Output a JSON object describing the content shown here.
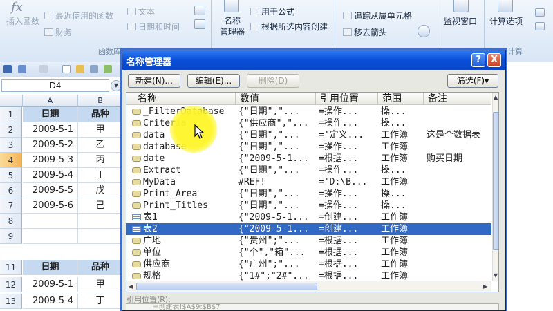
{
  "ribbon": {
    "insert_function": "插入函数",
    "recent": "最近使用的函数",
    "finance": "财务",
    "text": "文本",
    "datetime": "日期和时间",
    "function_library": "函数库",
    "name_manager": "名称\n管理器",
    "use_in_formula": "用于公式",
    "create_from_selection": "根据所选内容创建",
    "trace_dependents": "追踪从属单元格",
    "remove_arrows": "移去箭头",
    "watch_window": "监视窗口",
    "calc_options": "计算选项",
    "calc_group": "计算"
  },
  "namebox": "D4",
  "columns": [
    "A",
    "B"
  ],
  "rows": [
    {
      "n": "1",
      "a": "日期",
      "b": "品种",
      "header": true
    },
    {
      "n": "2",
      "a": "2009-5-1",
      "b": "甲"
    },
    {
      "n": "3",
      "a": "2009-5-2",
      "b": "乙"
    },
    {
      "n": "4",
      "a": "2009-5-3",
      "b": "丙",
      "active": true
    },
    {
      "n": "5",
      "a": "2009-5-4",
      "b": "丁"
    },
    {
      "n": "6",
      "a": "2009-5-5",
      "b": "戊"
    },
    {
      "n": "7",
      "a": "2009-5-6",
      "b": "己"
    },
    {
      "n": "8",
      "a": "",
      "b": ""
    },
    {
      "n": "9",
      "a": "",
      "b": ""
    },
    {
      "n": "11",
      "a": "日期",
      "b": "品种",
      "header": true
    },
    {
      "n": "12",
      "a": "2009-5-1",
      "b": "甲"
    },
    {
      "n": "13",
      "a": "2009-5-4",
      "b": "丁"
    }
  ],
  "dialog": {
    "title": "名称管理器",
    "help": "?",
    "close": "X",
    "new_btn": "新建(N)...",
    "edit_btn": "编辑(E)...",
    "delete_btn": "删除(D)",
    "filter_btn": "筛选(F)▾",
    "headers": [
      "名称",
      "数值",
      "引用位置",
      "范围",
      "备注"
    ],
    "items": [
      {
        "name": "_FilterDatabase",
        "value": "{\"日期\",\"...",
        "ref": "=操作...",
        "scope": "操...",
        "note": "",
        "icon": "name"
      },
      {
        "name": "Criteria",
        "value": "{\"供应商\",\"...",
        "ref": "=操作...",
        "scope": "操...",
        "note": "",
        "icon": "name"
      },
      {
        "name": "data",
        "value": "{\"日期\",\"...",
        "ref": "='定义...",
        "scope": "工作簿",
        "note": "这是个数据表",
        "icon": "name"
      },
      {
        "name": "database",
        "value": "{\"日期\",\"...",
        "ref": "=操作...",
        "scope": "工作簿",
        "note": "",
        "icon": "name"
      },
      {
        "name": "date",
        "value": "{\"2009-5-1...",
        "ref": "=根据...",
        "scope": "工作簿",
        "note": "购买日期",
        "icon": "name"
      },
      {
        "name": "Extract",
        "value": "{\"日期\",\"...",
        "ref": "=操作...",
        "scope": "操...",
        "note": "",
        "icon": "name"
      },
      {
        "name": "MyData",
        "value": "#REF!",
        "ref": "='D:\\B...",
        "scope": "工作簿",
        "note": "",
        "icon": "name"
      },
      {
        "name": "Print_Area",
        "value": "{\"日期\",\"...",
        "ref": "=操作...",
        "scope": "操...",
        "note": "",
        "icon": "name"
      },
      {
        "name": "Print_Titles",
        "value": "{\"日期\",\"...",
        "ref": "=操作...",
        "scope": "操...",
        "note": "",
        "icon": "name"
      },
      {
        "name": "表1",
        "value": "{\"2009-5-1...",
        "ref": "=创建...",
        "scope": "工作簿",
        "note": "",
        "icon": "table"
      },
      {
        "name": "表2",
        "value": "{\"2009-5-1...",
        "ref": "=创建...",
        "scope": "工作簿",
        "note": "",
        "icon": "table",
        "selected": true
      },
      {
        "name": "广地",
        "value": "{\"贵州\";\"...",
        "ref": "=根据...",
        "scope": "工作簿",
        "note": "",
        "icon": "name"
      },
      {
        "name": "单位",
        "value": "{\"个\",\"箱\"...",
        "ref": "=根据...",
        "scope": "工作簿",
        "note": "",
        "icon": "name"
      },
      {
        "name": "供应商",
        "value": "{\"广州\";\"...",
        "ref": "=根据...",
        "scope": "工作簿",
        "note": "",
        "icon": "name"
      },
      {
        "name": "规格",
        "value": "{\"1#\";\"2#\"...",
        "ref": "=根据...",
        "scope": "工作簿",
        "note": "",
        "icon": "name"
      }
    ],
    "ref_label": "引用位置(R):",
    "ref_value": "=创建表!$A$9:$B$7"
  }
}
